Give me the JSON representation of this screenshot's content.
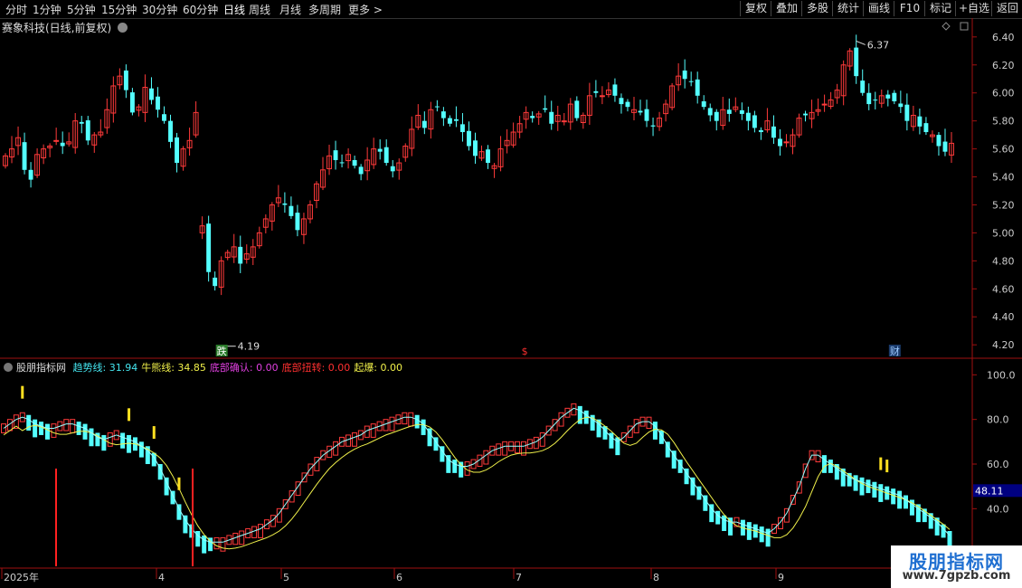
{
  "toolbar": {
    "timeframes": [
      "分时",
      "1分钟",
      "5分钟",
      "15分钟",
      "30分钟",
      "60分钟",
      "日线",
      "周线",
      "月线",
      "多周期",
      "更多 >"
    ],
    "active": "日线",
    "right_buttons": [
      "复权",
      "叠加",
      "多股",
      "统计",
      "画线",
      "F10",
      "标记",
      "+自选",
      "返回"
    ]
  },
  "main_panel": {
    "title": "赛象科技(日线,前复权)",
    "high_label": "6.37",
    "low_label": "4.19",
    "markers": [
      "跌",
      "$",
      "财"
    ]
  },
  "indicator_panel": {
    "name": "股朋指标网",
    "items": [
      {
        "label": "趋势线:",
        "value": "31.94",
        "color": "#45e6f0"
      },
      {
        "label": "牛熊线:",
        "value": "34.85",
        "color": "#f0f04a"
      },
      {
        "label": "底部确认:",
        "value": "0.00",
        "color": "#e040e0"
      },
      {
        "label": "底部扭转:",
        "value": "0.00",
        "color": "#ff3030"
      },
      {
        "label": "起爆:",
        "value": "0.00",
        "color": "#f0f04a"
      }
    ],
    "current_value": "48.11"
  },
  "date_axis": [
    "2025年",
    "4",
    "5",
    "6",
    "7",
    "8",
    "9"
  ],
  "watermark": {
    "name": "股朋指标网",
    "url": "www.7gpzb.com"
  },
  "chart_data": [
    {
      "type": "candlestick",
      "title": "赛象科技(日线,前复权)",
      "y_ticks": [
        4.2,
        4.4,
        4.6,
        4.8,
        5.0,
        5.2,
        5.4,
        5.6,
        5.8,
        6.0,
        6.2,
        6.4
      ],
      "ylim": [
        4.13,
        6.47
      ],
      "x_months": [
        "2025年",
        "4",
        "5",
        "6",
        "7",
        "8",
        "9"
      ],
      "annotations": {
        "high": 6.37,
        "low": 4.19
      },
      "close": [
        5.55,
        5.6,
        5.68,
        5.45,
        5.38,
        5.56,
        5.6,
        5.62,
        5.66,
        5.62,
        5.65,
        5.8,
        5.78,
        5.66,
        5.7,
        5.72,
        5.88,
        6.05,
        6.12,
        6.02,
        5.86,
        5.9,
        6.04,
        5.95,
        5.88,
        5.8,
        5.65,
        5.5,
        5.6,
        5.66,
        5.86,
        5.05,
        4.72,
        4.62,
        4.8,
        4.86,
        4.9,
        4.78,
        4.85,
        4.9,
        5.0,
        5.1,
        5.2,
        5.25,
        5.2,
        5.12,
        5.02,
        5.1,
        5.2,
        5.35,
        5.45,
        5.55,
        5.52,
        5.5,
        5.56,
        5.48,
        5.42,
        5.52,
        5.6,
        5.58,
        5.5,
        5.44,
        5.5,
        5.62,
        5.74,
        5.84,
        5.75,
        5.88,
        5.9,
        5.82,
        5.78,
        5.8,
        5.72,
        5.62,
        5.55,
        5.58,
        5.5,
        5.48,
        5.6,
        5.66,
        5.72,
        5.78,
        5.86,
        5.82,
        5.85,
        5.88,
        5.78,
        5.84,
        5.8,
        5.92,
        5.82,
        5.84,
        5.98,
        6.0,
        5.98,
        6.02,
        5.98,
        5.92,
        5.9,
        5.88,
        5.86,
        5.8,
        5.76,
        5.82,
        5.92,
        6.05,
        6.12,
        6.1,
        6.08,
        5.98,
        5.9,
        5.84,
        5.8,
        5.88,
        5.85,
        5.9,
        5.85,
        5.8,
        5.75,
        5.72,
        5.8,
        5.68,
        5.62,
        5.65,
        5.7,
        5.82,
        5.84,
        5.86,
        5.88,
        5.92,
        5.95,
        6.02,
        6.2,
        6.3,
        6.12,
        6.0,
        5.92,
        5.95,
        5.98,
        5.96,
        5.94,
        5.9,
        5.8,
        5.84,
        5.76,
        5.72,
        5.7,
        5.62,
        5.58,
        5.64
      ],
      "series": [
        {
          "name": "趋势线",
          "color": "#45e6f0"
        },
        {
          "name": "牛熊线",
          "color": "#f0f04a"
        }
      ]
    },
    {
      "type": "bar",
      "name": "股朋指标网",
      "y_ticks": [
        20.0,
        40.0,
        60.0,
        80.0,
        100.0
      ],
      "ylim": [
        15,
        105
      ],
      "current_value": 48.11,
      "trend": [
        78,
        80,
        82,
        83,
        82,
        80,
        79,
        78,
        78,
        79,
        80,
        80,
        79,
        78,
        76,
        74,
        73,
        74,
        75,
        74,
        73,
        72,
        70,
        68,
        65,
        60,
        54,
        48,
        42,
        37,
        33,
        30,
        28,
        27,
        27,
        27,
        28,
        29,
        30,
        31,
        32,
        33,
        35,
        37,
        40,
        44,
        48,
        52,
        56,
        60,
        63,
        66,
        68,
        70,
        72,
        73,
        74,
        75,
        77,
        78,
        79,
        80,
        81,
        82,
        83,
        83,
        82,
        80,
        76,
        72,
        68,
        64,
        62,
        61,
        61,
        62,
        64,
        66,
        68,
        69,
        70,
        70,
        70,
        70,
        71,
        72,
        74,
        77,
        80,
        83,
        85,
        87,
        86,
        84,
        82,
        80,
        77,
        74,
        72,
        74,
        77,
        80,
        81,
        81,
        79,
        75,
        70,
        66,
        62,
        58,
        54,
        50,
        46,
        42,
        39,
        37,
        36,
        36,
        35,
        34,
        33,
        32,
        31,
        33,
        36,
        40,
        46,
        52,
        60,
        66,
        66,
        64,
        62,
        60,
        58,
        56,
        55,
        54,
        53,
        52,
        51,
        50,
        49,
        48,
        46,
        44,
        42,
        40,
        38,
        36,
        33,
        30
      ],
      "signals": [
        3,
        20,
        24,
        28,
        140,
        141
      ]
    }
  ]
}
